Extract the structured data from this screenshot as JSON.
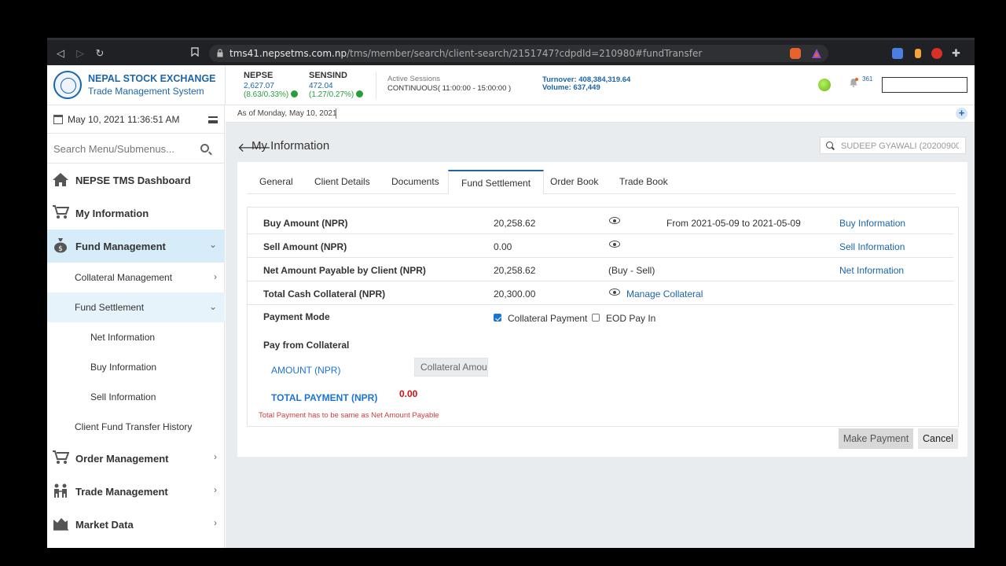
{
  "browser": {
    "url_domain": "tms41.nepsetms.com.np",
    "url_path": "/tms/member/search/client-search/2151747?cdpdId=210980#fundTransfer"
  },
  "header": {
    "brand_title": "NEPAL STOCK EXCHANGE",
    "brand_subtitle": "Trade Management System",
    "indices": [
      {
        "name": "NEPSE",
        "value": "2,627.07",
        "change": "(8.63/0.33%)"
      },
      {
        "name": "SENSIND",
        "value": "472.04",
        "change": "(1.27/0.27%)"
      }
    ],
    "session_label": "Active Sessions",
    "session_value": "CONTINUOUS( 11:00:00 - 15:00:00 )",
    "turnover": "Turnover: 408,384,319.64",
    "volume": "Volume: 637,449",
    "notification_count": "361",
    "status_color": "#64b618"
  },
  "sidebar": {
    "datetime": "May 10, 2021 11:36:51 AM",
    "search_placeholder": "Search Menu/Submenus...",
    "items": [
      {
        "label": "NEPSE TMS Dashboard",
        "icon": "home-icon"
      },
      {
        "label": "My Information",
        "icon": "cart-icon"
      },
      {
        "label": "Fund Management",
        "icon": "money-bag-icon"
      },
      {
        "label": "Order Management",
        "icon": "cart-icon"
      },
      {
        "label": "Trade Management",
        "icon": "people-icon"
      },
      {
        "label": "Market Data",
        "icon": "chart-icon"
      }
    ],
    "sub": {
      "collateral": "Collateral Management",
      "fund_settlement": "Fund Settlement",
      "net_info": "Net Information",
      "buy_info": "Buy Information",
      "sell_info": "Sell Information",
      "history": "Client Fund Transfer History"
    }
  },
  "main": {
    "as_of": "As of Monday, May 10, 2021",
    "page_title": "My Information",
    "client_search": "SUDEEP GYAWALI (20200900",
    "tabs": [
      "General",
      "Client Details",
      "Documents",
      "Fund Settlement",
      "Order Book",
      "Trade Book"
    ],
    "rows": {
      "buy": {
        "label": "Buy Amount (NPR)",
        "value": "20,258.62",
        "note": "From 2021-05-09 to 2021-05-09",
        "link": "Buy Information"
      },
      "sell": {
        "label": "Sell Amount (NPR)",
        "value": "0.00",
        "link": "Sell Information"
      },
      "net": {
        "label": "Net Amount Payable by Client (NPR)",
        "value": "20,258.62",
        "note": "(Buy - Sell)",
        "link": "Net Information"
      },
      "collateral": {
        "label": "Total Cash Collateral (NPR)",
        "value": "20,300.00",
        "link": "Manage Collateral"
      }
    },
    "payment_mode_label": "Payment Mode",
    "opt_collateral": "Collateral Payment",
    "opt_eod": "EOD Pay In",
    "pay_from_collateral": "Pay from Collateral",
    "amount_label": "AMOUNT (NPR)",
    "amount_placeholder": "Collateral Amou",
    "total_label": "TOTAL PAYMENT (NPR)",
    "total_value": "0.00",
    "warning": "Total Payment has to be same as Net Amount Payable",
    "make_payment": "Make Payment",
    "cancel": "Cancel"
  }
}
